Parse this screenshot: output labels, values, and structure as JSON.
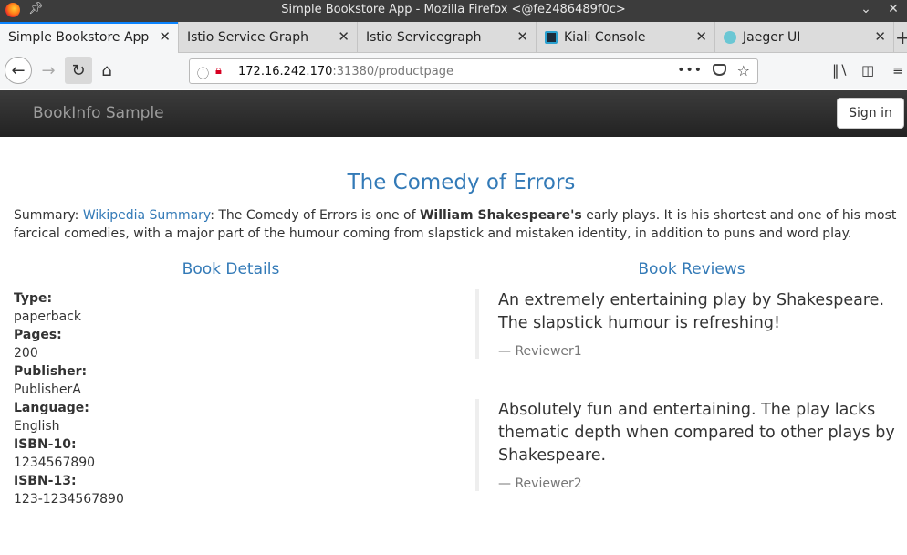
{
  "window": {
    "title": "Simple Bookstore App - Mozilla Firefox <@fe2486489f0c>"
  },
  "tabs": [
    {
      "label": "Simple Bookstore App",
      "active": true
    },
    {
      "label": "Istio Service Graph",
      "active": false
    },
    {
      "label": "Istio Servicegraph",
      "active": false
    },
    {
      "label": "Kiali Console",
      "active": false,
      "favicon": "kiali-icon"
    },
    {
      "label": "Jaeger UI",
      "active": false,
      "favicon": "jaeger-icon"
    }
  ],
  "urlbar": {
    "host": "172.16.242.170",
    "path": ":31380/productpage"
  },
  "app": {
    "brand": "BookInfo Sample",
    "signin_label": "Sign in"
  },
  "book": {
    "title": "The Comedy of Errors",
    "summary_prefix": "Summary: ",
    "summary_link": "Wikipedia Summary",
    "summary_text_1": ": The Comedy of Errors is one of ",
    "summary_bold": "William Shakespeare's",
    "summary_text_2": " early plays. It is his shortest and one of his most farcical comedies, with a major part of the humour coming from slapstick and mistaken identity, in addition to puns and word play."
  },
  "details": {
    "heading": "Book Details",
    "items": [
      {
        "label": "Type:",
        "value": "paperback"
      },
      {
        "label": "Pages:",
        "value": "200"
      },
      {
        "label": "Publisher:",
        "value": "PublisherA"
      },
      {
        "label": "Language:",
        "value": "English"
      },
      {
        "label": "ISBN-10:",
        "value": "1234567890"
      },
      {
        "label": "ISBN-13:",
        "value": "123-1234567890"
      }
    ]
  },
  "reviews": {
    "heading": "Book Reviews",
    "items": [
      {
        "text": "An extremely entertaining play by Shakespeare. The slapstick humour is refreshing!",
        "reviewer": "— Reviewer1"
      },
      {
        "text": "Absolutely fun and entertaining. The play lacks thematic depth when compared to other plays by Shakespeare.",
        "reviewer": "— Reviewer2"
      }
    ]
  },
  "colors": {
    "link": "#337ab7",
    "navbar": "#222222",
    "tab_accent": "#0a84ff"
  }
}
